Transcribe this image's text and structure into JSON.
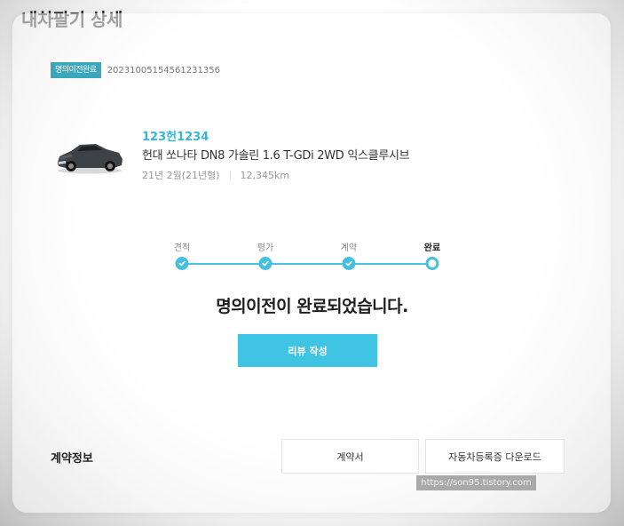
{
  "page": {
    "title": "내차팔기 상세"
  },
  "order": {
    "status_badge": "명의이전완료",
    "number": "20231005154561231356"
  },
  "vehicle": {
    "image_icon": "car-photo",
    "plate": "123헌1234",
    "name": "헌대 쏘나타 DN8 가솔린 1.6 T-GDi 2WD 익스클루시브",
    "year": "21년 2월(21년형)",
    "mileage": "12,345km"
  },
  "progress": {
    "steps": [
      {
        "label": "견적",
        "done": true
      },
      {
        "label": "평가",
        "done": true
      },
      {
        "label": "계약",
        "done": true
      },
      {
        "label": "완료",
        "done": false,
        "current": true
      }
    ],
    "accent_color": "#45c0df"
  },
  "message": "명의이전이 완료되었습니다.",
  "actions": {
    "review_label": "리뷰 작성"
  },
  "contract": {
    "section_title": "계약정보",
    "contract_button": "계약서",
    "registration_button": "자동차등록증 다운로드"
  },
  "watermark": "https://son95.tistory.com"
}
